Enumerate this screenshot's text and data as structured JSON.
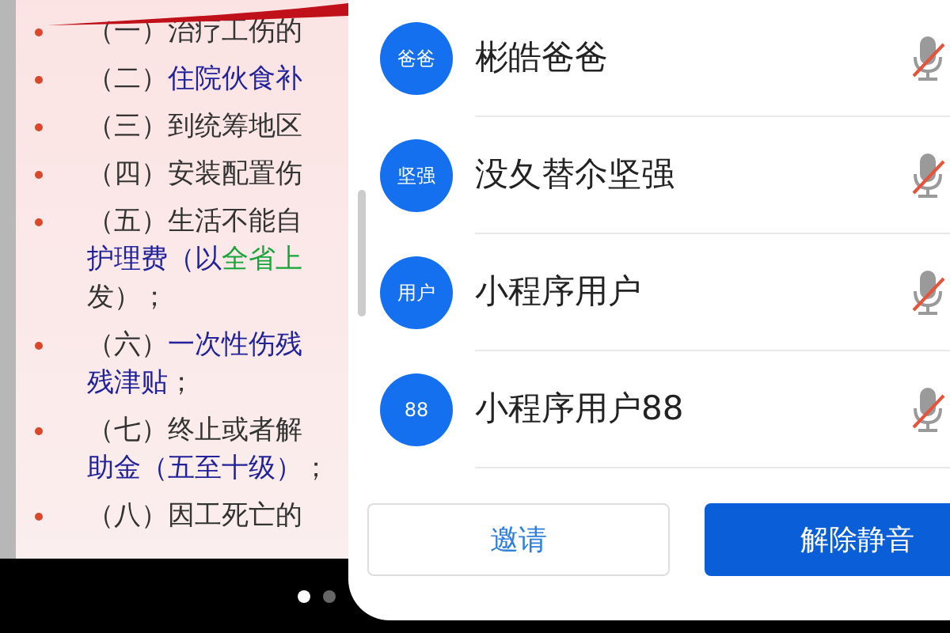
{
  "slide": {
    "items": [
      {
        "bullet": true,
        "segments": [
          {
            "color": "#333333",
            "text": "（一）治疗工伤的"
          }
        ]
      },
      {
        "bullet": true,
        "segments": [
          {
            "color": "#333333",
            "text": "（二）"
          },
          {
            "color": "#22229a",
            "text": "住院伙食补"
          }
        ]
      },
      {
        "bullet": true,
        "segments": [
          {
            "color": "#333333",
            "text": "（三）到统筹地区"
          }
        ]
      },
      {
        "bullet": true,
        "segments": [
          {
            "color": "#333333",
            "text": "（四）安装配置伤"
          }
        ]
      },
      {
        "bullet": true,
        "segments": [
          {
            "color": "#333333",
            "text": "（五）生活不能自"
          }
        ]
      },
      {
        "bullet": false,
        "segments": [
          {
            "color": "#22229a",
            "text": "护理费（以"
          },
          {
            "color": "#1aa53a",
            "text": "全省上"
          }
        ]
      },
      {
        "bullet": false,
        "segments": [
          {
            "color": "#333333",
            "text": "发）；"
          }
        ]
      },
      {
        "bullet": true,
        "segments": [
          {
            "color": "#333333",
            "text": "（六）"
          },
          {
            "color": "#22229a",
            "text": "一次性伤残"
          }
        ]
      },
      {
        "bullet": false,
        "segments": [
          {
            "color": "#22229a",
            "text": "残津贴"
          },
          {
            "color": "#333333",
            "text": "；"
          }
        ]
      },
      {
        "bullet": true,
        "segments": [
          {
            "color": "#333333",
            "text": "（七）终止或者解"
          }
        ]
      },
      {
        "bullet": false,
        "segments": [
          {
            "color": "#22229a",
            "text": "助金（五至十级）"
          },
          {
            "color": "#333333",
            "text": "；"
          }
        ]
      },
      {
        "bullet": true,
        "segments": [
          {
            "color": "#333333",
            "text": "（八）因工死亡的"
          }
        ]
      }
    ]
  },
  "pager": [
    {
      "selected": true
    },
    {
      "selected": false
    }
  ],
  "participants": [
    {
      "avatar": "爸爸",
      "name": "彬皓爸爸",
      "muted": true
    },
    {
      "avatar": "坚强",
      "name": "没夂替尒坚强",
      "muted": true
    },
    {
      "avatar": "用户",
      "name": "小程序用户",
      "muted": true
    },
    {
      "avatar": "88",
      "name": "小程序用户88",
      "muted": true
    }
  ],
  "buttons": [
    {
      "kind": "outline",
      "label": "邀请"
    },
    {
      "kind": "primary",
      "label": "解除静音"
    }
  ]
}
